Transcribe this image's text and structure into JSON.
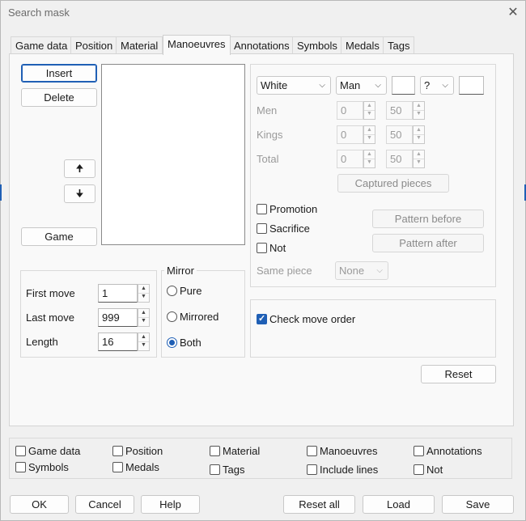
{
  "window": {
    "title": "Search mask",
    "close_glyph": "✕"
  },
  "tabs": [
    {
      "label": "Game data"
    },
    {
      "label": "Position"
    },
    {
      "label": "Material"
    },
    {
      "label": "Manoeuvres"
    },
    {
      "label": "Annotations"
    },
    {
      "label": "Symbols"
    },
    {
      "label": "Medals"
    },
    {
      "label": "Tags"
    }
  ],
  "active_tab": "Manoeuvres",
  "left": {
    "insert": "Insert",
    "delete": "Delete",
    "up_glyph": "🠉",
    "down_glyph": "🠋",
    "game": "Game"
  },
  "moves": {
    "first_label": "First move",
    "first_value": "1",
    "last_label": "Last move",
    "last_value": "999",
    "length_label": "Length",
    "length_value": "16"
  },
  "mirror": {
    "title": "Mirror",
    "options": [
      {
        "label": "Pure",
        "checked": false
      },
      {
        "label": "Mirrored",
        "checked": false
      },
      {
        "label": "Both",
        "checked": true
      }
    ]
  },
  "piece": {
    "color": "White",
    "type": "Man",
    "square_a": "",
    "operator": "?",
    "square_b": "",
    "rows": [
      {
        "label": "Men",
        "min": "0",
        "max": "50"
      },
      {
        "label": "Kings",
        "min": "0",
        "max": "50"
      },
      {
        "label": "Total",
        "min": "0",
        "max": "50"
      }
    ],
    "captured": "Captured pieces",
    "promotion": "Promotion",
    "sacrifice": "Sacrifice",
    "not": "Not",
    "pattern_before": "Pattern before",
    "pattern_after": "Pattern after",
    "same_piece_label": "Same piece",
    "same_piece_value": "None"
  },
  "order": {
    "label": "Check move order",
    "checked": true
  },
  "reset": "Reset",
  "include": {
    "items": [
      {
        "label": "Game data"
      },
      {
        "label": "Position"
      },
      {
        "label": "Material"
      },
      {
        "label": "Manoeuvres"
      },
      {
        "label": "Annotations"
      },
      {
        "label": "Symbols"
      },
      {
        "label": "Medals"
      },
      {
        "label": "Tags"
      },
      {
        "label": "Include lines"
      },
      {
        "label": "Not"
      }
    ]
  },
  "footer": {
    "ok": "OK",
    "cancel": "Cancel",
    "help": "Help",
    "reset_all": "Reset all",
    "load": "Load",
    "save": "Save"
  },
  "colors": {
    "accent": "#1f5fb5"
  }
}
